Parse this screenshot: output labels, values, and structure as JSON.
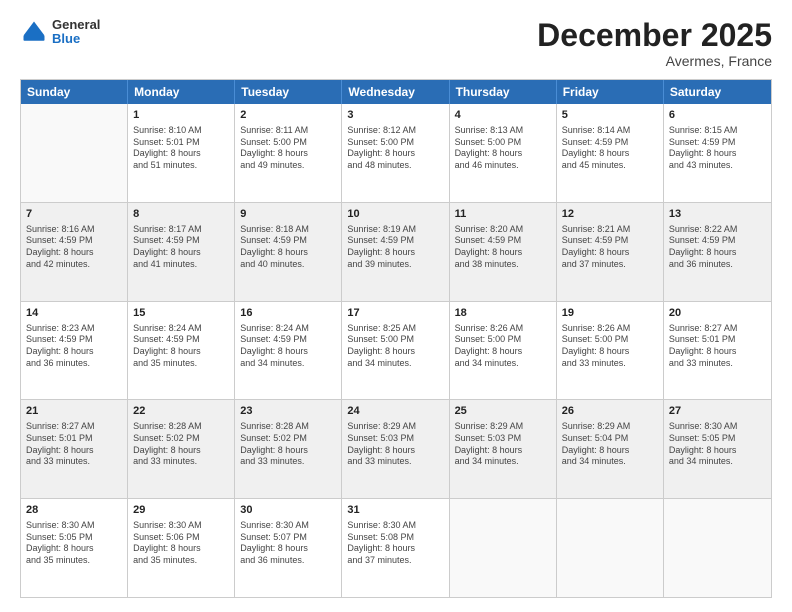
{
  "header": {
    "logo": {
      "general": "General",
      "blue": "Blue"
    },
    "title": "December 2025",
    "location": "Avermes, France"
  },
  "calendar": {
    "days": [
      "Sunday",
      "Monday",
      "Tuesday",
      "Wednesday",
      "Thursday",
      "Friday",
      "Saturday"
    ],
    "rows": [
      [
        {
          "day": "",
          "empty": true
        },
        {
          "day": "1",
          "lines": [
            "Sunrise: 8:10 AM",
            "Sunset: 5:01 PM",
            "Daylight: 8 hours",
            "and 51 minutes."
          ]
        },
        {
          "day": "2",
          "lines": [
            "Sunrise: 8:11 AM",
            "Sunset: 5:00 PM",
            "Daylight: 8 hours",
            "and 49 minutes."
          ]
        },
        {
          "day": "3",
          "lines": [
            "Sunrise: 8:12 AM",
            "Sunset: 5:00 PM",
            "Daylight: 8 hours",
            "and 48 minutes."
          ]
        },
        {
          "day": "4",
          "lines": [
            "Sunrise: 8:13 AM",
            "Sunset: 5:00 PM",
            "Daylight: 8 hours",
            "and 46 minutes."
          ]
        },
        {
          "day": "5",
          "lines": [
            "Sunrise: 8:14 AM",
            "Sunset: 4:59 PM",
            "Daylight: 8 hours",
            "and 45 minutes."
          ]
        },
        {
          "day": "6",
          "lines": [
            "Sunrise: 8:15 AM",
            "Sunset: 4:59 PM",
            "Daylight: 8 hours",
            "and 43 minutes."
          ]
        }
      ],
      [
        {
          "day": "7",
          "lines": [
            "Sunrise: 8:16 AM",
            "Sunset: 4:59 PM",
            "Daylight: 8 hours",
            "and 42 minutes."
          ]
        },
        {
          "day": "8",
          "lines": [
            "Sunrise: 8:17 AM",
            "Sunset: 4:59 PM",
            "Daylight: 8 hours",
            "and 41 minutes."
          ]
        },
        {
          "day": "9",
          "lines": [
            "Sunrise: 8:18 AM",
            "Sunset: 4:59 PM",
            "Daylight: 8 hours",
            "and 40 minutes."
          ]
        },
        {
          "day": "10",
          "lines": [
            "Sunrise: 8:19 AM",
            "Sunset: 4:59 PM",
            "Daylight: 8 hours",
            "and 39 minutes."
          ]
        },
        {
          "day": "11",
          "lines": [
            "Sunrise: 8:20 AM",
            "Sunset: 4:59 PM",
            "Daylight: 8 hours",
            "and 38 minutes."
          ]
        },
        {
          "day": "12",
          "lines": [
            "Sunrise: 8:21 AM",
            "Sunset: 4:59 PM",
            "Daylight: 8 hours",
            "and 37 minutes."
          ]
        },
        {
          "day": "13",
          "lines": [
            "Sunrise: 8:22 AM",
            "Sunset: 4:59 PM",
            "Daylight: 8 hours",
            "and 36 minutes."
          ]
        }
      ],
      [
        {
          "day": "14",
          "lines": [
            "Sunrise: 8:23 AM",
            "Sunset: 4:59 PM",
            "Daylight: 8 hours",
            "and 36 minutes."
          ]
        },
        {
          "day": "15",
          "lines": [
            "Sunrise: 8:24 AM",
            "Sunset: 4:59 PM",
            "Daylight: 8 hours",
            "and 35 minutes."
          ]
        },
        {
          "day": "16",
          "lines": [
            "Sunrise: 8:24 AM",
            "Sunset: 4:59 PM",
            "Daylight: 8 hours",
            "and 34 minutes."
          ]
        },
        {
          "day": "17",
          "lines": [
            "Sunrise: 8:25 AM",
            "Sunset: 5:00 PM",
            "Daylight: 8 hours",
            "and 34 minutes."
          ]
        },
        {
          "day": "18",
          "lines": [
            "Sunrise: 8:26 AM",
            "Sunset: 5:00 PM",
            "Daylight: 8 hours",
            "and 34 minutes."
          ]
        },
        {
          "day": "19",
          "lines": [
            "Sunrise: 8:26 AM",
            "Sunset: 5:00 PM",
            "Daylight: 8 hours",
            "and 33 minutes."
          ]
        },
        {
          "day": "20",
          "lines": [
            "Sunrise: 8:27 AM",
            "Sunset: 5:01 PM",
            "Daylight: 8 hours",
            "and 33 minutes."
          ]
        }
      ],
      [
        {
          "day": "21",
          "lines": [
            "Sunrise: 8:27 AM",
            "Sunset: 5:01 PM",
            "Daylight: 8 hours",
            "and 33 minutes."
          ]
        },
        {
          "day": "22",
          "lines": [
            "Sunrise: 8:28 AM",
            "Sunset: 5:02 PM",
            "Daylight: 8 hours",
            "and 33 minutes."
          ]
        },
        {
          "day": "23",
          "lines": [
            "Sunrise: 8:28 AM",
            "Sunset: 5:02 PM",
            "Daylight: 8 hours",
            "and 33 minutes."
          ]
        },
        {
          "day": "24",
          "lines": [
            "Sunrise: 8:29 AM",
            "Sunset: 5:03 PM",
            "Daylight: 8 hours",
            "and 33 minutes."
          ]
        },
        {
          "day": "25",
          "lines": [
            "Sunrise: 8:29 AM",
            "Sunset: 5:03 PM",
            "Daylight: 8 hours",
            "and 34 minutes."
          ]
        },
        {
          "day": "26",
          "lines": [
            "Sunrise: 8:29 AM",
            "Sunset: 5:04 PM",
            "Daylight: 8 hours",
            "and 34 minutes."
          ]
        },
        {
          "day": "27",
          "lines": [
            "Sunrise: 8:30 AM",
            "Sunset: 5:05 PM",
            "Daylight: 8 hours",
            "and 34 minutes."
          ]
        }
      ],
      [
        {
          "day": "28",
          "lines": [
            "Sunrise: 8:30 AM",
            "Sunset: 5:05 PM",
            "Daylight: 8 hours",
            "and 35 minutes."
          ]
        },
        {
          "day": "29",
          "lines": [
            "Sunrise: 8:30 AM",
            "Sunset: 5:06 PM",
            "Daylight: 8 hours",
            "and 35 minutes."
          ]
        },
        {
          "day": "30",
          "lines": [
            "Sunrise: 8:30 AM",
            "Sunset: 5:07 PM",
            "Daylight: 8 hours",
            "and 36 minutes."
          ]
        },
        {
          "day": "31",
          "lines": [
            "Sunrise: 8:30 AM",
            "Sunset: 5:08 PM",
            "Daylight: 8 hours",
            "and 37 minutes."
          ]
        },
        {
          "day": "",
          "empty": true
        },
        {
          "day": "",
          "empty": true
        },
        {
          "day": "",
          "empty": true
        }
      ]
    ]
  }
}
